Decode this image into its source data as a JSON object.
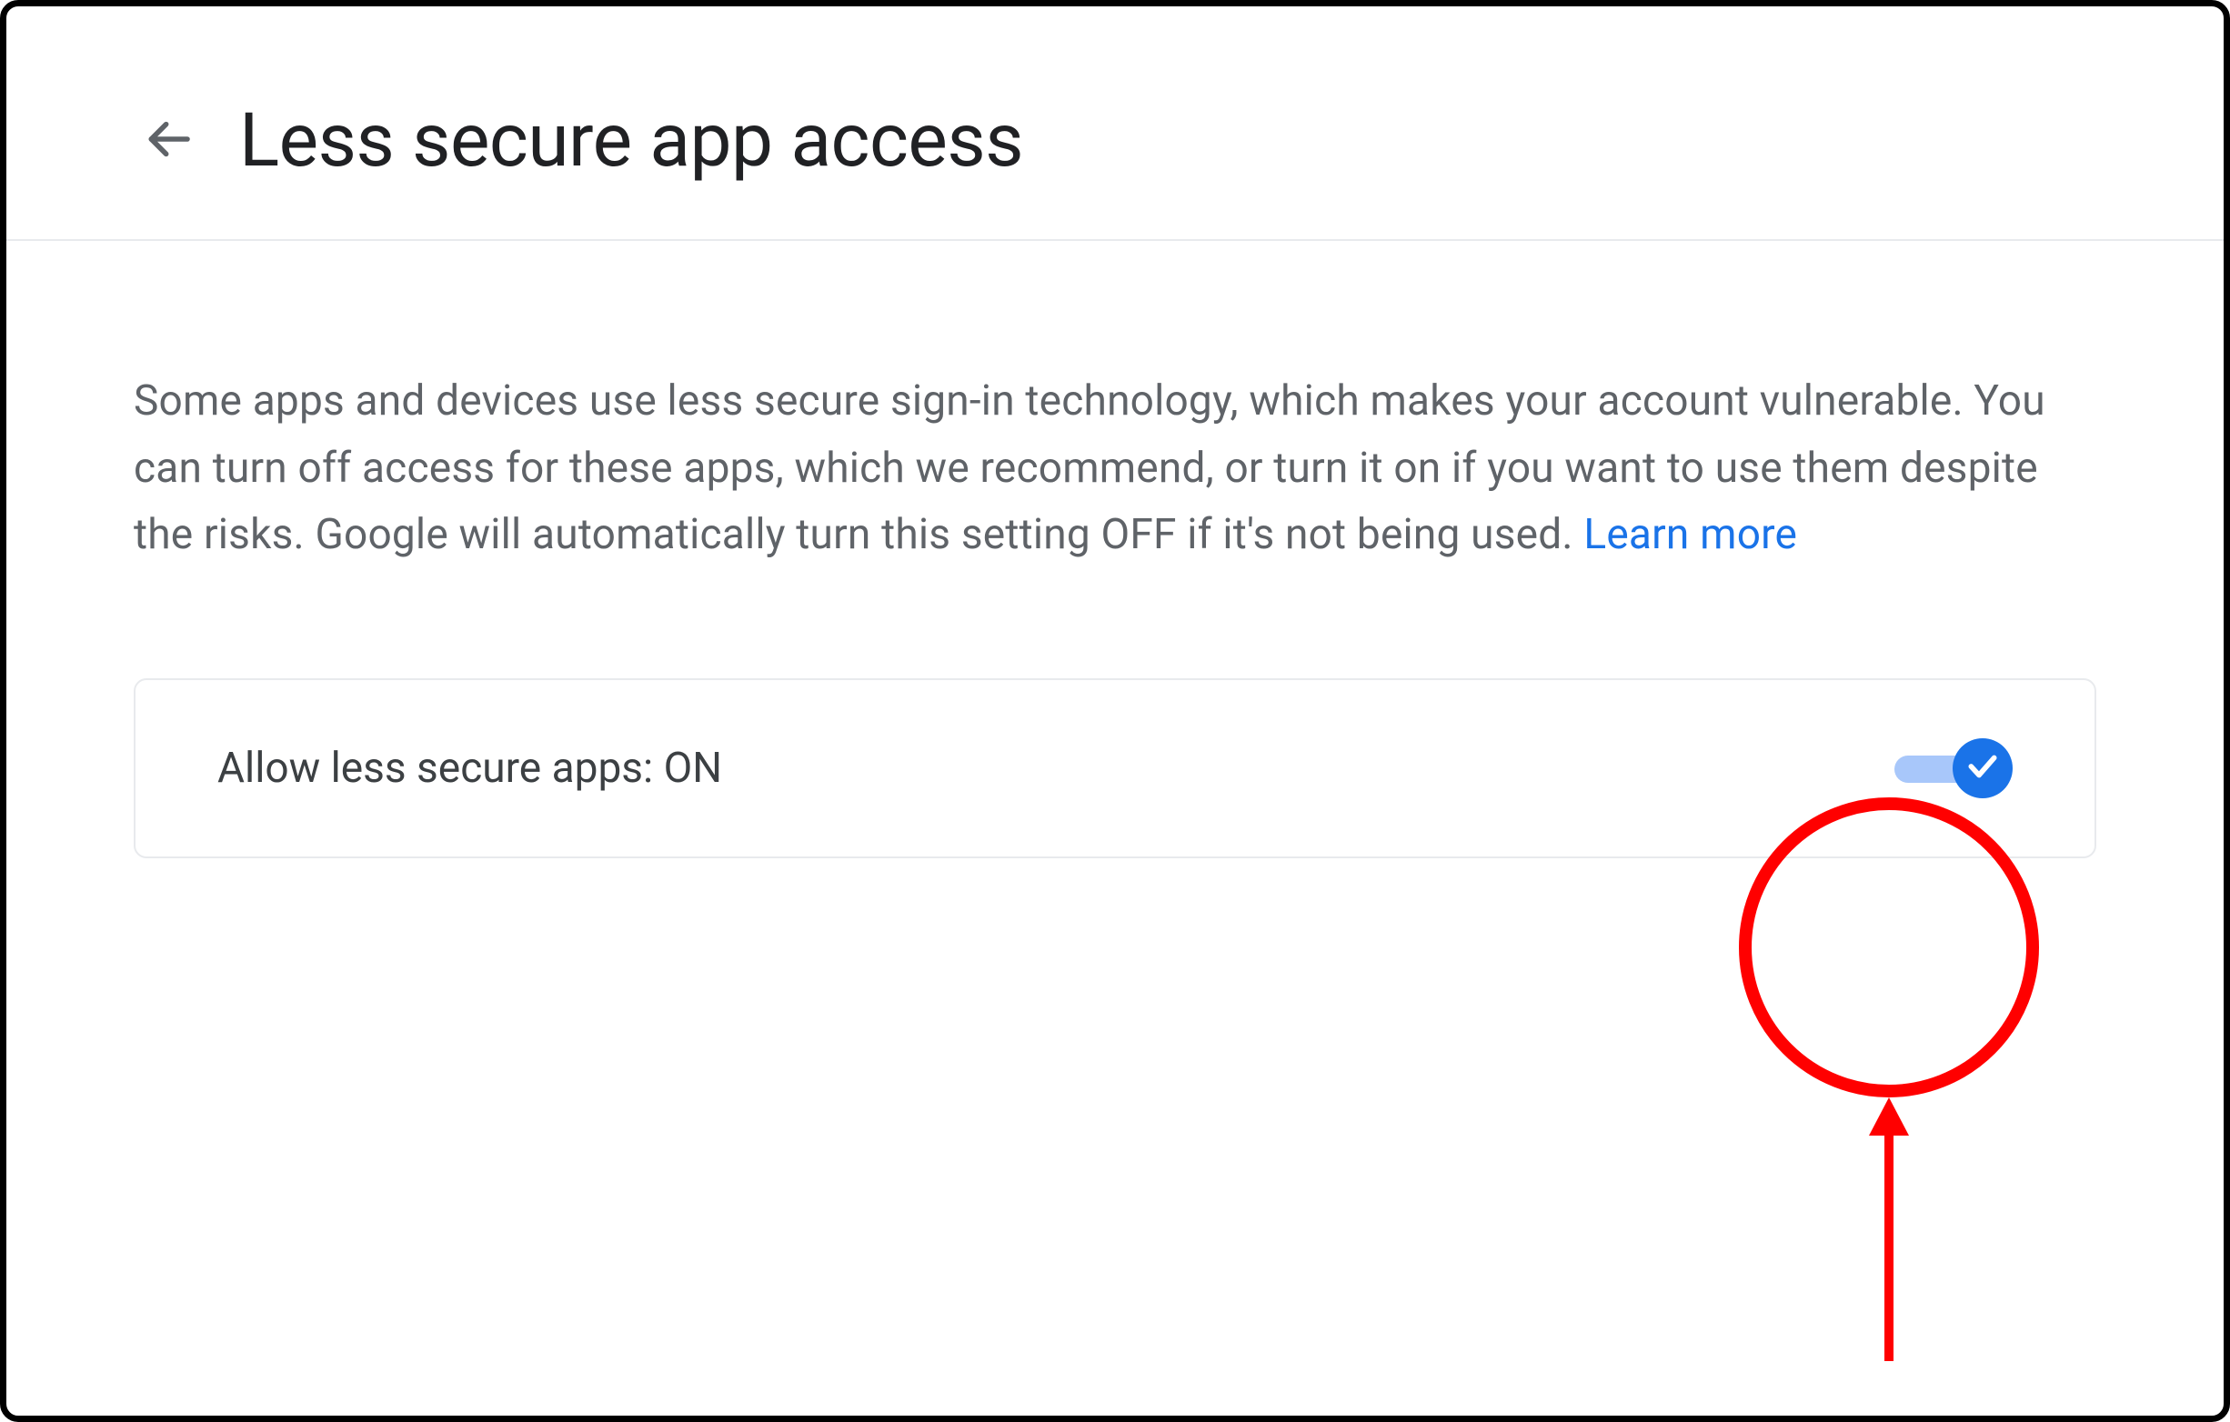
{
  "header": {
    "title": "Less secure app access"
  },
  "description": {
    "text": "Some apps and devices use less secure sign-in technology, which makes your account vulnerable. You can turn off access for these apps, which we recommend, or turn it on if you want to use them despite the risks. Google will automatically turn this setting OFF if it's not being used. ",
    "learn_more": "Learn more"
  },
  "setting": {
    "label": "Allow less secure apps: ON",
    "state": "ON"
  },
  "colors": {
    "accent": "#1a73e8",
    "annotation": "#ff0000"
  }
}
